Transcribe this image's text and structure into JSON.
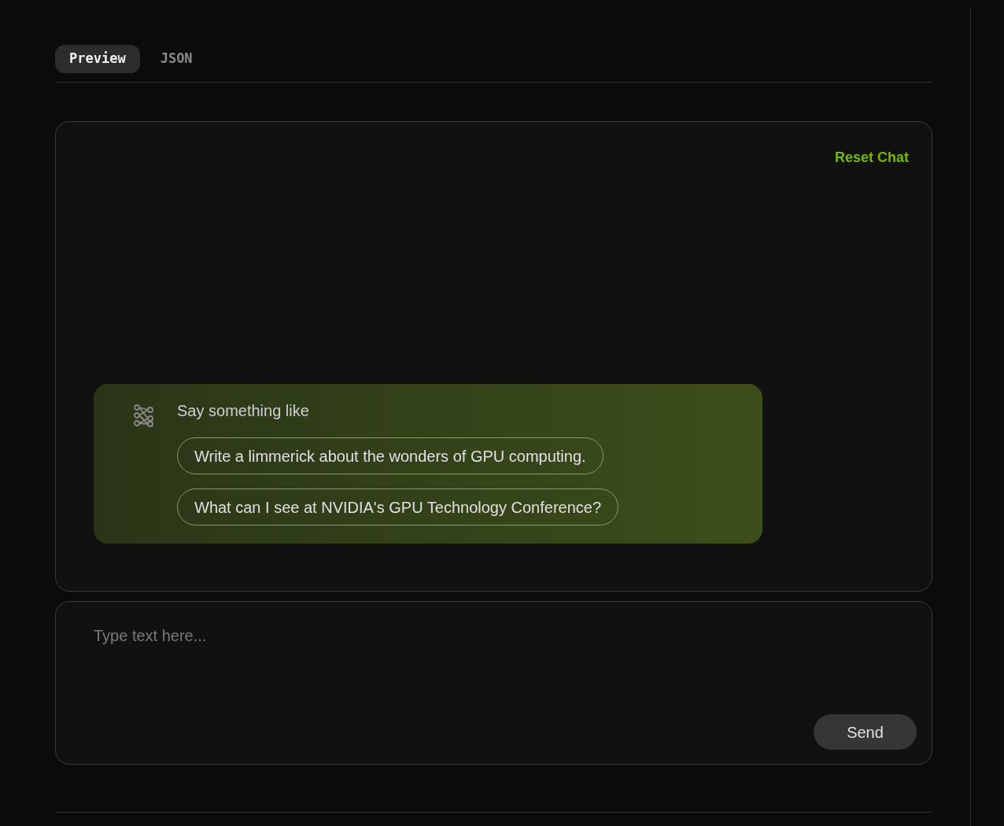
{
  "tabs": [
    {
      "label": "Preview",
      "selected": true
    },
    {
      "label": "JSON",
      "selected": false
    }
  ],
  "chat": {
    "reset_label": "Reset Chat",
    "prompt": "Say something like",
    "suggestions": [
      "Write a limmerick about the wonders of GPU computing.",
      "What can I see at NVIDIA's GPU Technology Conference?"
    ]
  },
  "composer": {
    "placeholder": "Type text here...",
    "send_label": "Send"
  }
}
